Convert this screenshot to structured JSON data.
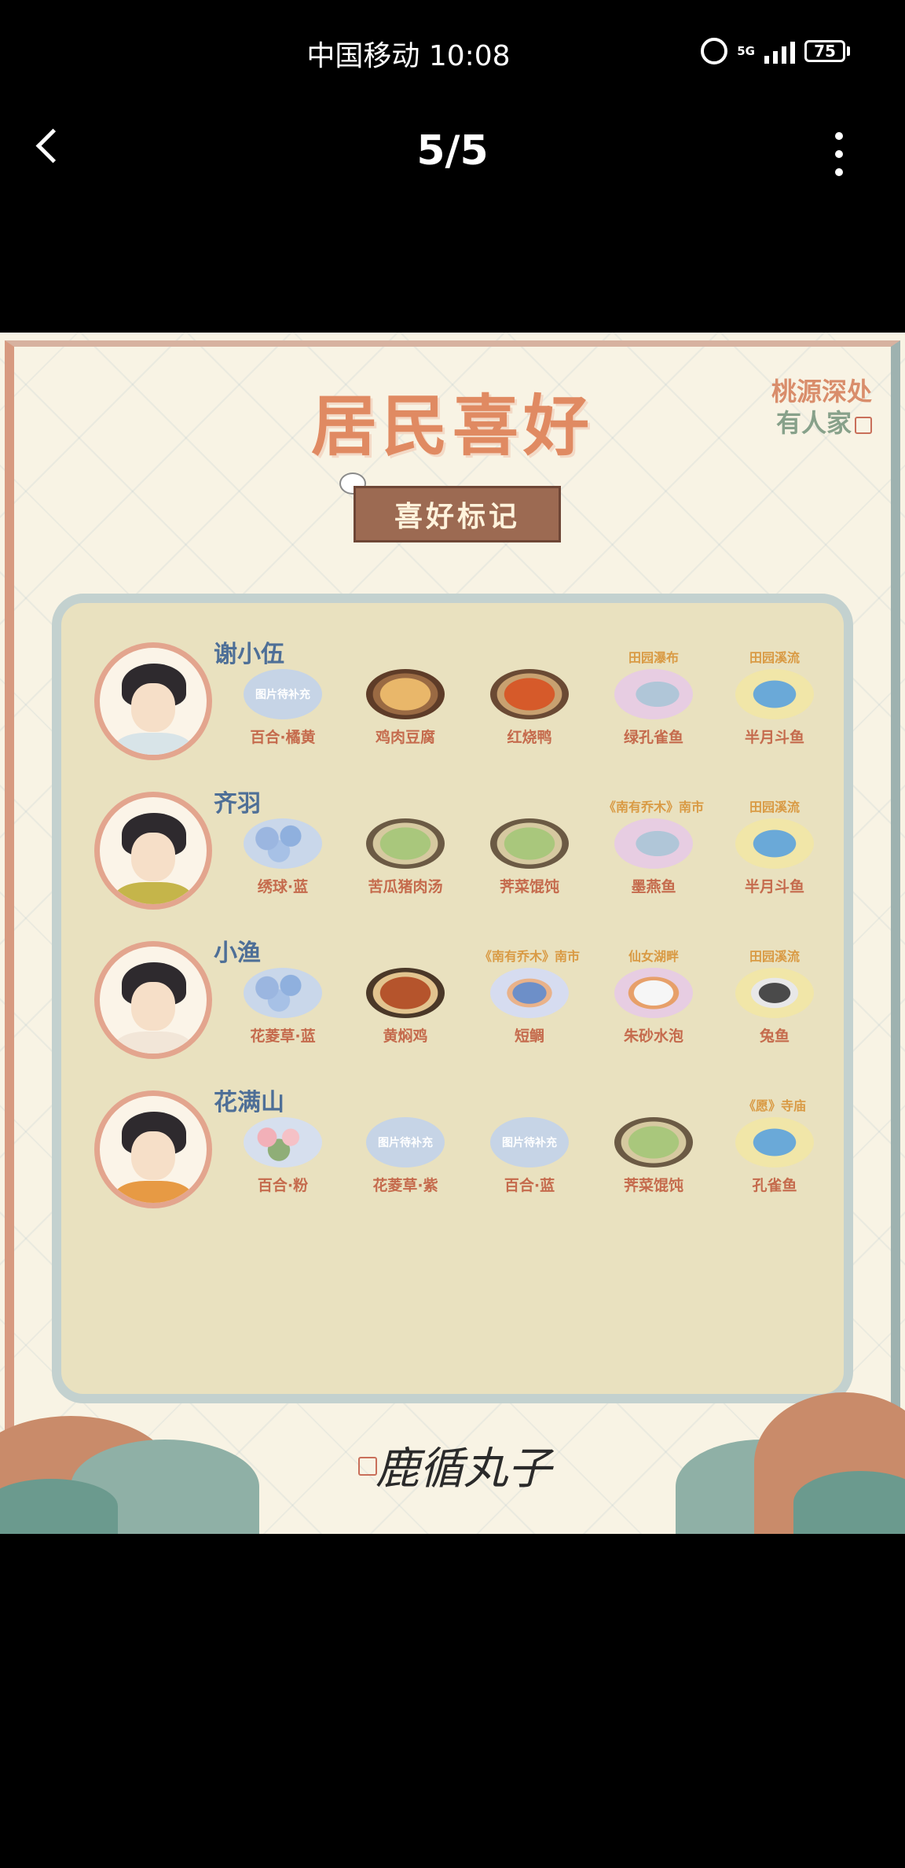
{
  "status": {
    "time": "中国移动 10:08",
    "network": "5G",
    "battery": "75"
  },
  "viewer": {
    "counter": "5/5"
  },
  "poster": {
    "title": "居民喜好",
    "brand_line1": "桃源深处",
    "brand_line2": "有人家",
    "tag": "喜好标记",
    "signature": "鹿循丸子",
    "residents": [
      {
        "name": "谢小伍",
        "items": [
          {
            "label": "百合·橘黄",
            "sub": "",
            "pic": "placeholder",
            "ph": "图片待补充"
          },
          {
            "label": "鸡肉豆腐",
            "sub": "",
            "pic": "dish",
            "ph": ""
          },
          {
            "label": "红烧鸭",
            "sub": "",
            "pic": "dish-red",
            "ph": ""
          },
          {
            "label": "绿孔雀鱼",
            "sub": "田园瀑布",
            "pic": "fish-pink",
            "ph": ""
          },
          {
            "label": "半月斗鱼",
            "sub": "田园溪流",
            "pic": "fish-yellow",
            "ph": ""
          }
        ]
      },
      {
        "name": "齐羽",
        "items": [
          {
            "label": "绣球·蓝",
            "sub": "",
            "pic": "flower-blue",
            "ph": ""
          },
          {
            "label": "苦瓜猪肉汤",
            "sub": "",
            "pic": "dish-green",
            "ph": ""
          },
          {
            "label": "荠菜馄饨",
            "sub": "",
            "pic": "dish-green",
            "ph": ""
          },
          {
            "label": "墨燕鱼",
            "sub": "《南有乔木》南市",
            "pic": "fish-pink",
            "ph": ""
          },
          {
            "label": "半月斗鱼",
            "sub": "田园溪流",
            "pic": "fish-yellow",
            "ph": ""
          }
        ]
      },
      {
        "name": "小渔",
        "items": [
          {
            "label": "花菱草·蓝",
            "sub": "",
            "pic": "flower-blue",
            "ph": ""
          },
          {
            "label": "黄焖鸡",
            "sub": "",
            "pic": "dish-brown",
            "ph": ""
          },
          {
            "label": "短鲷",
            "sub": "《南有乔木》南市",
            "pic": "fish-blue",
            "ph": ""
          },
          {
            "label": "朱砂水泡",
            "sub": "仙女湖畔",
            "pic": "fish-white",
            "ph": ""
          },
          {
            "label": "兔鱼",
            "sub": "田园溪流",
            "pic": "fish-bw",
            "ph": ""
          }
        ]
      },
      {
        "name": "花满山",
        "items": [
          {
            "label": "百合·粉",
            "sub": "",
            "pic": "flower-pink",
            "ph": ""
          },
          {
            "label": "花菱草·紫",
            "sub": "",
            "pic": "placeholder",
            "ph": "图片待补充"
          },
          {
            "label": "百合·蓝",
            "sub": "",
            "pic": "placeholder",
            "ph": "图片待补充"
          },
          {
            "label": "荠菜馄饨",
            "sub": "",
            "pic": "dish-green",
            "ph": ""
          },
          {
            "label": "孔雀鱼",
            "sub": "《愿》寺庙",
            "pic": "fish-yellow",
            "ph": ""
          }
        ]
      }
    ]
  }
}
